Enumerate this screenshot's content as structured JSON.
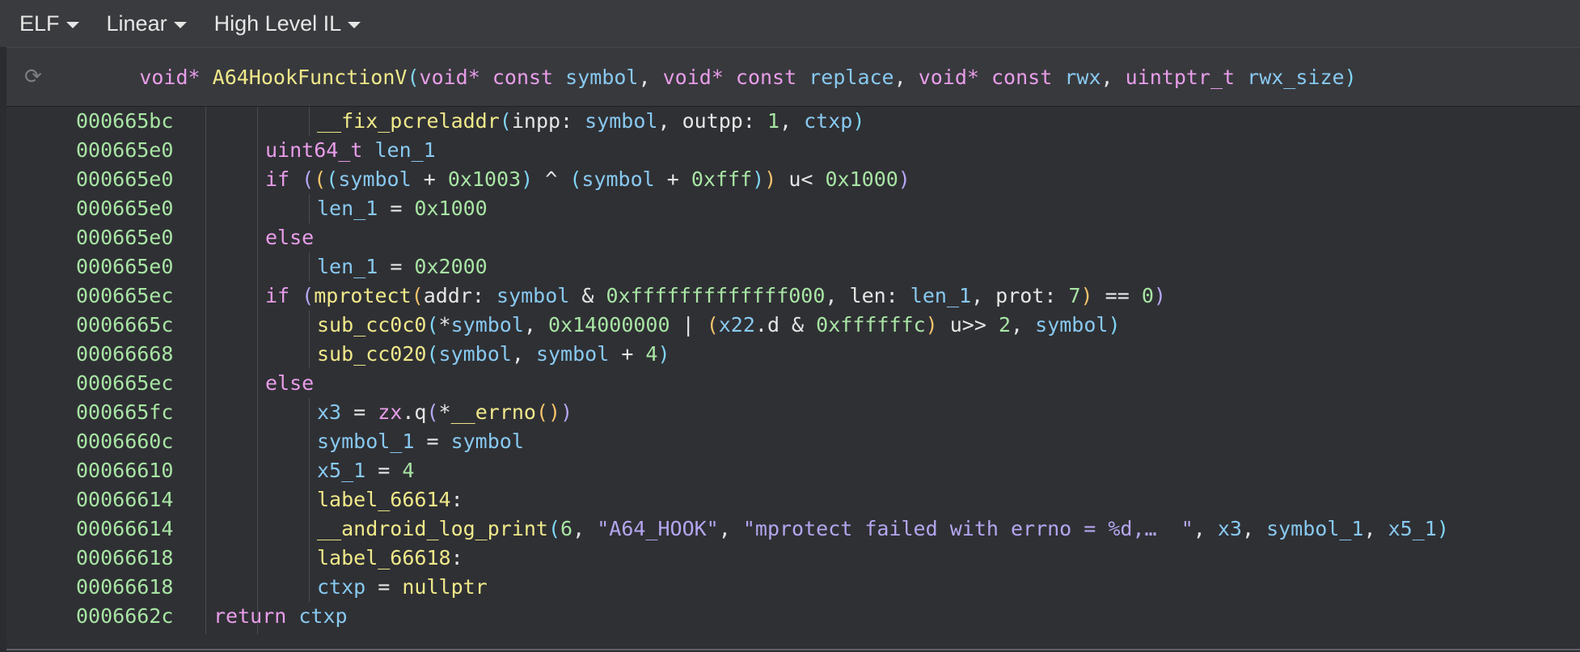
{
  "toolbar": {
    "items": [
      "ELF",
      "Linear",
      "High Level IL"
    ]
  },
  "signature": {
    "return_type": "void*",
    "name": "A64HookFunctionV",
    "params": [
      {
        "type": "void* const",
        "name": "symbol"
      },
      {
        "type": "void* const",
        "name": "replace"
      },
      {
        "type": "void* const",
        "name": "rwx"
      },
      {
        "type": "uintptr_t",
        "name": "rwx_size"
      }
    ]
  },
  "colors": {
    "background": "#2b2c30",
    "address": "#a8e5a4",
    "keyword": "#e89de9",
    "function": "#f0e98a",
    "variable": "#88c9f0",
    "number": "#a8e5a4",
    "string": "#b4a6f0"
  },
  "icons": [
    "refresh-icon",
    "chevron-down-icon"
  ],
  "lines": [
    {
      "addr": "000665bc",
      "indent": 3,
      "tokens": [
        [
          "fn",
          "__fix_pcreladdr"
        ],
        [
          "p1",
          "("
        ],
        [
          "pl",
          "inpp: "
        ],
        [
          "var",
          "symbol"
        ],
        [
          "pl",
          ", outpp: "
        ],
        [
          "num",
          "1"
        ],
        [
          "pl",
          ", "
        ],
        [
          "var",
          "ctxp"
        ],
        [
          "p1",
          ")"
        ]
      ]
    },
    {
      "addr": "000665e0",
      "indent": 2,
      "tokens": [
        [
          "kw",
          "uint64_t "
        ],
        [
          "var",
          "len_1"
        ]
      ]
    },
    {
      "addr": "000665e0",
      "indent": 2,
      "tokens": [
        [
          "kw",
          "if "
        ],
        [
          "p3",
          "("
        ],
        [
          "p2",
          "("
        ],
        [
          "p1",
          "("
        ],
        [
          "var",
          "symbol"
        ],
        [
          "pl",
          " + "
        ],
        [
          "num",
          "0x1003"
        ],
        [
          "p1",
          ")"
        ],
        [
          "pl",
          " ^ "
        ],
        [
          "p1",
          "("
        ],
        [
          "var",
          "symbol"
        ],
        [
          "pl",
          " + "
        ],
        [
          "num",
          "0xfff"
        ],
        [
          "p1",
          ")"
        ],
        [
          "p2",
          ")"
        ],
        [
          "pl",
          " u< "
        ],
        [
          "num",
          "0x1000"
        ],
        [
          "p3",
          ")"
        ]
      ]
    },
    {
      "addr": "000665e0",
      "indent": 3,
      "tokens": [
        [
          "var",
          "len_1"
        ],
        [
          "pl",
          " = "
        ],
        [
          "num",
          "0x1000"
        ]
      ]
    },
    {
      "addr": "000665e0",
      "indent": 2,
      "tokens": [
        [
          "kw",
          "else"
        ]
      ]
    },
    {
      "addr": "000665e0",
      "indent": 3,
      "tokens": [
        [
          "var",
          "len_1"
        ],
        [
          "pl",
          " = "
        ],
        [
          "num",
          "0x2000"
        ]
      ]
    },
    {
      "addr": "000665ec",
      "indent": 2,
      "tokens": [
        [
          "kw",
          "if "
        ],
        [
          "p3",
          "("
        ],
        [
          "fn",
          "mprotect"
        ],
        [
          "p2",
          "("
        ],
        [
          "pl",
          "addr: "
        ],
        [
          "var",
          "symbol"
        ],
        [
          "pl",
          " & "
        ],
        [
          "num",
          "0xfffffffffffff000"
        ],
        [
          "pl",
          ", len: "
        ],
        [
          "var",
          "len_1"
        ],
        [
          "pl",
          ", prot: "
        ],
        [
          "num",
          "7"
        ],
        [
          "p2",
          ")"
        ],
        [
          "pl",
          " == "
        ],
        [
          "num",
          "0"
        ],
        [
          "p3",
          ")"
        ]
      ]
    },
    {
      "addr": "0006665c",
      "indent": 3,
      "tokens": [
        [
          "fn",
          "sub_cc0c0"
        ],
        [
          "p1",
          "("
        ],
        [
          "pl",
          "*"
        ],
        [
          "var",
          "symbol"
        ],
        [
          "pl",
          ", "
        ],
        [
          "num",
          "0x14000000"
        ],
        [
          "pl",
          " | "
        ],
        [
          "p2",
          "("
        ],
        [
          "var",
          "x22"
        ],
        [
          "pl",
          ".d & "
        ],
        [
          "num",
          "0xffffffc"
        ],
        [
          "p2",
          ")"
        ],
        [
          "pl",
          " u>> "
        ],
        [
          "num",
          "2"
        ],
        [
          "pl",
          ", "
        ],
        [
          "var",
          "symbol"
        ],
        [
          "p1",
          ")"
        ]
      ]
    },
    {
      "addr": "00066668",
      "indent": 3,
      "tokens": [
        [
          "fn",
          "sub_cc020"
        ],
        [
          "p1",
          "("
        ],
        [
          "var",
          "symbol"
        ],
        [
          "pl",
          ", "
        ],
        [
          "var",
          "symbol"
        ],
        [
          "pl",
          " + "
        ],
        [
          "num",
          "4"
        ],
        [
          "p1",
          ")"
        ]
      ]
    },
    {
      "addr": "000665ec",
      "indent": 2,
      "tokens": [
        [
          "kw",
          "else"
        ]
      ]
    },
    {
      "addr": "000665fc",
      "indent": 3,
      "tokens": [
        [
          "var",
          "x3"
        ],
        [
          "pl",
          " = "
        ],
        [
          "kw",
          "zx"
        ],
        [
          "pl",
          ".q"
        ],
        [
          "p3",
          "("
        ],
        [
          "pl",
          "*"
        ],
        [
          "fn",
          "__errno"
        ],
        [
          "p2",
          "()"
        ],
        [
          "p3",
          ")"
        ]
      ]
    },
    {
      "addr": "0006660c",
      "indent": 3,
      "tokens": [
        [
          "var",
          "symbol_1"
        ],
        [
          "pl",
          " = "
        ],
        [
          "var",
          "symbol"
        ]
      ]
    },
    {
      "addr": "00066610",
      "indent": 3,
      "tokens": [
        [
          "var",
          "x5_1"
        ],
        [
          "pl",
          " = "
        ],
        [
          "num",
          "4"
        ]
      ]
    },
    {
      "addr": "00066614",
      "indent": 3,
      "tokens": [
        [
          "fn",
          "label_66614"
        ],
        [
          "pl",
          ":"
        ]
      ]
    },
    {
      "addr": "00066614",
      "indent": 3,
      "tokens": [
        [
          "fn",
          "__android_log_print"
        ],
        [
          "p1",
          "("
        ],
        [
          "num",
          "6"
        ],
        [
          "pl",
          ", "
        ],
        [
          "str",
          "\"A64_HOOK\""
        ],
        [
          "pl",
          ", "
        ],
        [
          "str",
          "\"mprotect failed with errno = %d,…  \""
        ],
        [
          "pl",
          ", "
        ],
        [
          "var",
          "x3"
        ],
        [
          "pl",
          ", "
        ],
        [
          "var",
          "symbol_1"
        ],
        [
          "pl",
          ", "
        ],
        [
          "var",
          "x5_1"
        ],
        [
          "p1",
          ")"
        ]
      ]
    },
    {
      "addr": "00066618",
      "indent": 3,
      "tokens": [
        [
          "fn",
          "label_66618"
        ],
        [
          "pl",
          ":"
        ]
      ]
    },
    {
      "addr": "00066618",
      "indent": 3,
      "tokens": [
        [
          "var",
          "ctxp"
        ],
        [
          "pl",
          " = "
        ],
        [
          "fn",
          "nullptr"
        ]
      ]
    },
    {
      "addr": "0006662c",
      "indent": 1,
      "tokens": [
        [
          "kw",
          "return "
        ],
        [
          "var",
          "ctxp"
        ]
      ]
    }
  ]
}
